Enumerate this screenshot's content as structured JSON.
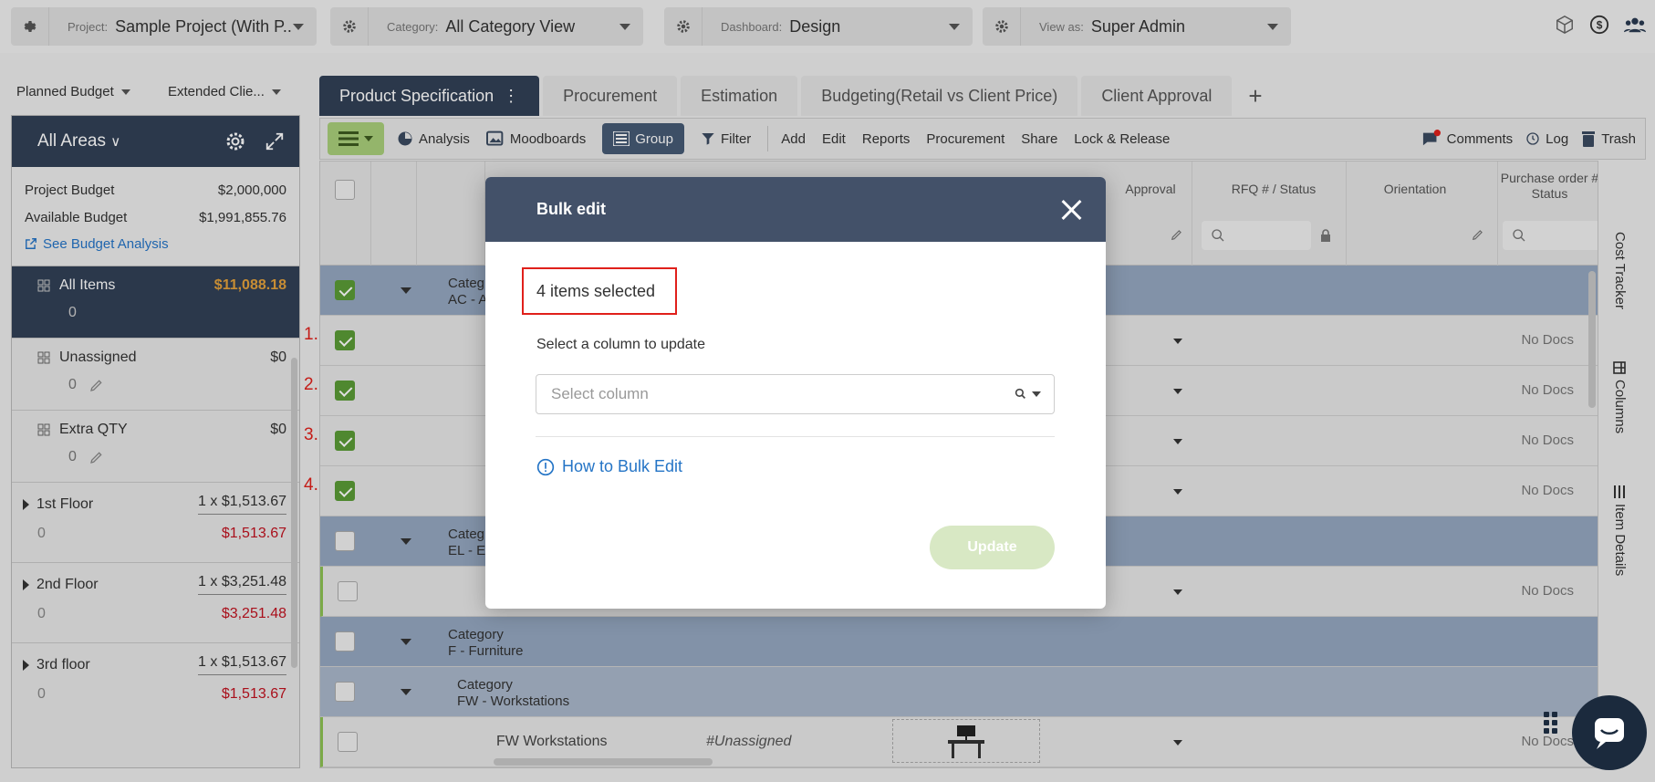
{
  "topbar": {
    "project": {
      "label": "Project:",
      "value": "Sample Project (With P..."
    },
    "category": {
      "label": "Category:",
      "value": "All Category View"
    },
    "dashboard": {
      "label": "Dashboard:",
      "value": "Design"
    },
    "view_as": {
      "label": "View as:",
      "value": "Super Admin"
    }
  },
  "budget_dropdowns": {
    "planned": "Planned Budget",
    "extended": "Extended Clie..."
  },
  "left_panel": {
    "title": "All Areas",
    "project_budget_label": "Project Budget",
    "project_budget_value": "$2,000,000",
    "available_budget_label": "Available Budget",
    "available_budget_value": "$1,991,855.76",
    "analysis_link": "See Budget Analysis",
    "items": [
      {
        "name": "All Items",
        "amount": "$11,088.18",
        "count": "0"
      },
      {
        "name": "Unassigned",
        "amount": "$0",
        "count": "0"
      },
      {
        "name": "Extra QTY",
        "amount": "$0",
        "count": "0"
      }
    ],
    "floors": [
      {
        "name": "1st Floor",
        "qty": "1 x $1,513.67",
        "count": "0",
        "total": "$1,513.67"
      },
      {
        "name": "2nd Floor",
        "qty": "1 x $3,251.48",
        "count": "0",
        "total": "$3,251.48"
      },
      {
        "name": "3rd floor",
        "qty": "1 x $1,513.67",
        "count": "0",
        "total": "$1,513.67"
      }
    ]
  },
  "tabs": [
    "Product Specification",
    "Procurement",
    "Estimation",
    "Budgeting(Retail vs Client Price)",
    "Client Approval"
  ],
  "tab_plus": "+",
  "toolbar": {
    "analysis": "Analysis",
    "moodboards": "Moodboards",
    "group": "Group",
    "filter": "Filter",
    "add": "Add",
    "edit": "Edit",
    "reports": "Reports",
    "procurement": "Procurement",
    "share": "Share",
    "lock_release": "Lock & Release",
    "comments": "Comments",
    "log": "Log",
    "trash": "Trash"
  },
  "grid": {
    "headers": {
      "approval": "Approval",
      "rfq": "RFQ # / Status",
      "orientation": "Orientation",
      "po": "Purchase order # Status"
    },
    "rows": [
      {
        "kind": "cat",
        "line1": "Categ",
        "line2": "AC - A"
      },
      {
        "kind": "data",
        "num": "1.",
        "docs": "No Docs"
      },
      {
        "kind": "data",
        "num": "2.",
        "docs": "No Docs"
      },
      {
        "kind": "data",
        "num": "3.",
        "docs": "No Docs"
      },
      {
        "kind": "data",
        "num": "4.",
        "docs": "No Docs"
      },
      {
        "kind": "cat",
        "line1": "Categ",
        "line2": "EL - E"
      },
      {
        "kind": "data",
        "docs": "No Docs"
      },
      {
        "kind": "cat",
        "line1": "Category",
        "line2": "F - Furniture"
      },
      {
        "kind": "subcat",
        "line1": "Category",
        "line2": "FW - Workstations"
      },
      {
        "kind": "data",
        "name": "FW Workstations",
        "assign": "#Unassigned",
        "docs": "No Docs"
      }
    ]
  },
  "side_labels": [
    "Cost Tracker",
    "Columns",
    "Item Details"
  ],
  "modal": {
    "title": "Bulk edit",
    "selected": "4 items selected",
    "column_label": "Select a column to update",
    "select_placeholder": "Select column",
    "help_link": "How to Bulk Edit",
    "update_button": "Update"
  }
}
